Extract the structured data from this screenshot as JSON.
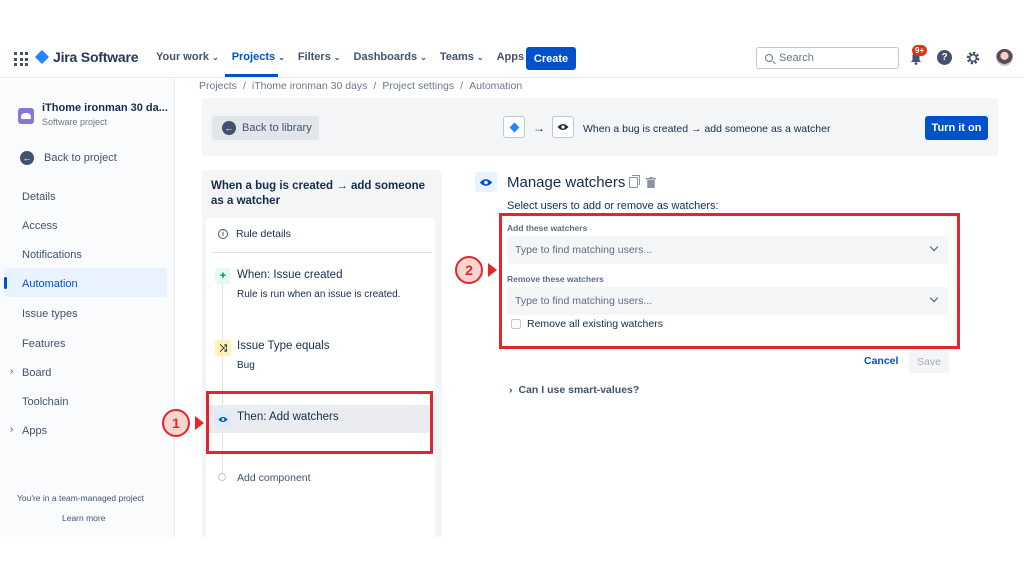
{
  "topnav": {
    "brand": "Jira Software",
    "items": [
      {
        "label": "Your work",
        "active": false
      },
      {
        "label": "Projects",
        "active": true
      },
      {
        "label": "Filters",
        "active": false
      },
      {
        "label": "Dashboards",
        "active": false
      },
      {
        "label": "Teams",
        "active": false
      },
      {
        "label": "Apps",
        "active": false
      }
    ],
    "create_label": "Create",
    "search_placeholder": "Search",
    "notification_badge": "9+",
    "help_label": "?"
  },
  "sidebar": {
    "project_name": "iThome ironman 30 da...",
    "project_type": "Software project",
    "back_label": "Back to project",
    "items": [
      "Details",
      "Access",
      "Notifications",
      "Automation",
      "Issue types",
      "Features",
      "Board",
      "Toolchain",
      "Apps"
    ],
    "active_item": "Automation",
    "team_note": "You're in a team-managed project",
    "learn_more": "Learn more"
  },
  "breadcrumb": [
    "Projects",
    "/",
    "iThome ironman 30 days",
    "/",
    "Project settings",
    "/",
    "Automation"
  ],
  "header": {
    "back_label": "Back to library",
    "flow_arrow": "→",
    "rule_title": "When a bug is created → add someone as a watcher",
    "turn_on_label": "Turn it on"
  },
  "rule": {
    "heading": "When a bug is created → add someone as a watcher",
    "details_label": "Rule details",
    "trigger_title": "When: Issue created",
    "trigger_sub": "Rule is run when an issue is created.",
    "condition_title": "Issue Type equals",
    "condition_sub": "Bug",
    "action_title": "Then: Add watchers",
    "add_component": "Add component"
  },
  "manage": {
    "title": "Manage watchers",
    "select_users": "Select users to add or remove as watchers:",
    "add_label": "Add these watchers",
    "add_placeholder": "Type to find matching users...",
    "remove_label": "Remove these watchers",
    "remove_placeholder": "Type to find matching users...",
    "remove_all_label": "Remove all existing watchers",
    "cancel_label": "Cancel",
    "save_label": "Save",
    "smart_values": "Can I use smart-values?"
  },
  "annotations": {
    "one": "1",
    "two": "2"
  },
  "colors": {
    "accent": "#0052cc",
    "annotation": "#e5252e"
  }
}
